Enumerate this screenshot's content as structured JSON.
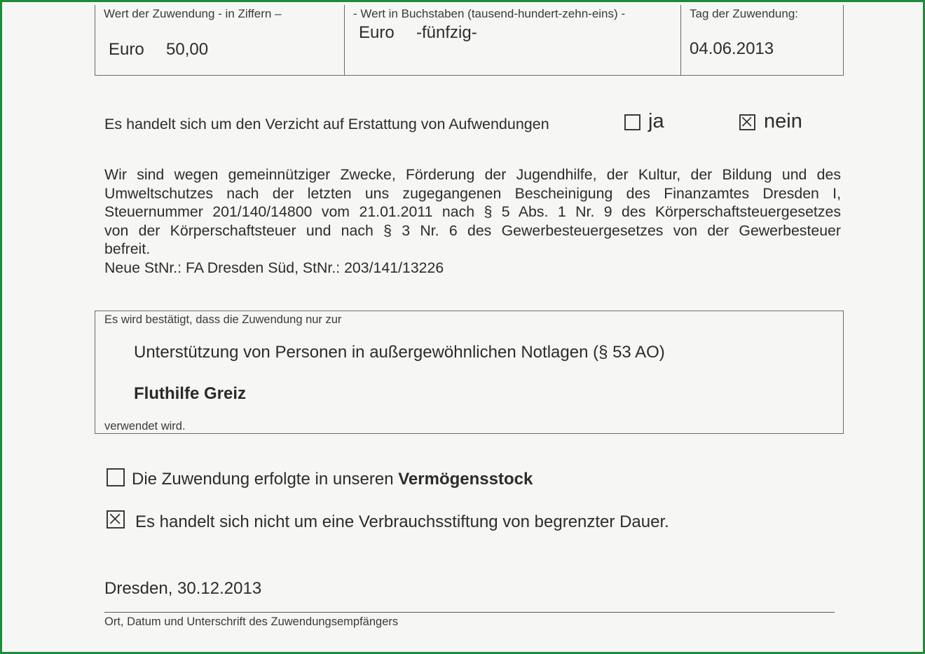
{
  "top_table": {
    "amount_digits_label": "Wert der Zuwendung - in Ziffern –",
    "amount_currency": "Euro",
    "amount_value": "50,00",
    "amount_words_label": "- Wert in Buchstaben (tausend-hundert-zehn-eins)  -",
    "amount_words_currency": "Euro",
    "amount_words_value": "-fünfzig-",
    "date_label": "Tag der Zuwendung:",
    "date_value": "04.06.2013"
  },
  "waiver": {
    "question": "Es handelt sich um den Verzicht auf Erstattung von Aufwendungen",
    "option_yes": "ja",
    "option_no": "nein",
    "yes_checked": false,
    "no_checked": true
  },
  "exemption": {
    "lines": [
      "Wir sind wegen gemeinnütziger Zwecke, Förderung der Jugendhilfe, der Kultur, der Bildung und des",
      "Umweltschutzes nach der letzten uns zugegangenen Bescheinigung des Finanzamtes Dresden I,",
      "Steuernummer 201/140/14800 vom 21.01.2011 nach § 5 Abs. 1 Nr. 9 des Körperschaftsteuergesetzes",
      "von der Körperschaftsteuer und nach § 3 Nr. 6 des Gewerbesteuergesetzes von der Gewerbesteuer",
      "befreit.",
      "Neue StNr.: FA Dresden Süd, StNr.: 203/141/13226"
    ]
  },
  "purpose": {
    "intro": "Es wird bestätigt, dass die Zuwendung nur zur",
    "purpose_text": "Unterstützung von Personen in außergewöhnlichen Notlagen (§ 53 AO)",
    "project": "Fluthilfe Greiz",
    "outro": "verwendet wird."
  },
  "options": {
    "vermoegensstock_prefix": "Die Zuwendung erfolgte in unseren ",
    "vermoegensstock_bold": "Vermögensstock",
    "vermoegensstock_checked": false,
    "verbrauch_text": "Es handelt sich nicht um eine Verbrauchsstiftung von begrenzter Dauer.",
    "verbrauch_checked": true
  },
  "signature": {
    "place_date": "Dresden, 30.12.2013",
    "caption": "Ort, Datum und Unterschrift des Zuwendungsempfängers"
  },
  "colors": {
    "frame_border": "#1e8a3c",
    "paper": "#f6f6f4",
    "ink": "#2c2c2c"
  }
}
